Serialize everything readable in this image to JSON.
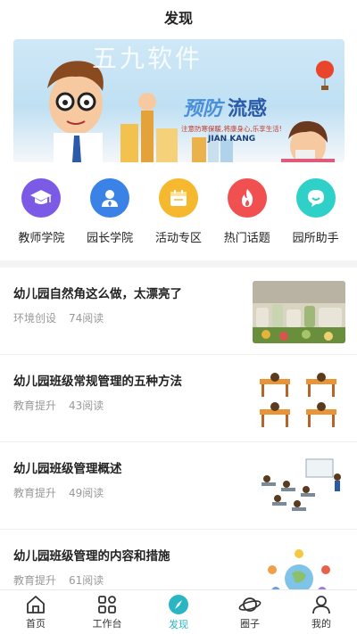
{
  "header": {
    "title": "发现"
  },
  "banner": {
    "watermark": "五九软件",
    "headline_1": "预防",
    "headline_2": "流感",
    "subtitle": "注意防寒保暖,将康身心,乐享生活!",
    "english": "JIAN KANG"
  },
  "categories": [
    {
      "label": "教师学院",
      "icon": "graduation-cap-icon",
      "color": "#7b5be6"
    },
    {
      "label": "园长学院",
      "icon": "person-icon",
      "color": "#3b82e6"
    },
    {
      "label": "活动专区",
      "icon": "calendar-icon",
      "color": "#f5b82e"
    },
    {
      "label": "热门话题",
      "icon": "flame-icon",
      "color": "#f0504f"
    },
    {
      "label": "园所助手",
      "icon": "chat-icon",
      "color": "#2fd0c8"
    }
  ],
  "articles": [
    {
      "title": "幼儿园自然角这么做，太漂亮了",
      "tag": "环境创设",
      "reads": "74阅读"
    },
    {
      "title": "幼儿园班级常规管理的五种方法",
      "tag": "教育提升",
      "reads": "43阅读"
    },
    {
      "title": "幼儿园班级管理概述",
      "tag": "教育提升",
      "reads": "49阅读"
    },
    {
      "title": "幼儿园班级管理的内容和措施",
      "tag": "教育提升",
      "reads": "61阅读"
    }
  ],
  "tabs": [
    {
      "label": "首页",
      "icon": "home-icon"
    },
    {
      "label": "工作台",
      "icon": "grid-icon"
    },
    {
      "label": "发现",
      "icon": "compass-icon",
      "active": true
    },
    {
      "label": "圈子",
      "icon": "planet-icon"
    },
    {
      "label": "我的",
      "icon": "profile-icon"
    }
  ],
  "colors": {
    "accent": "#2ab5c4",
    "muted_text": "#999999"
  }
}
